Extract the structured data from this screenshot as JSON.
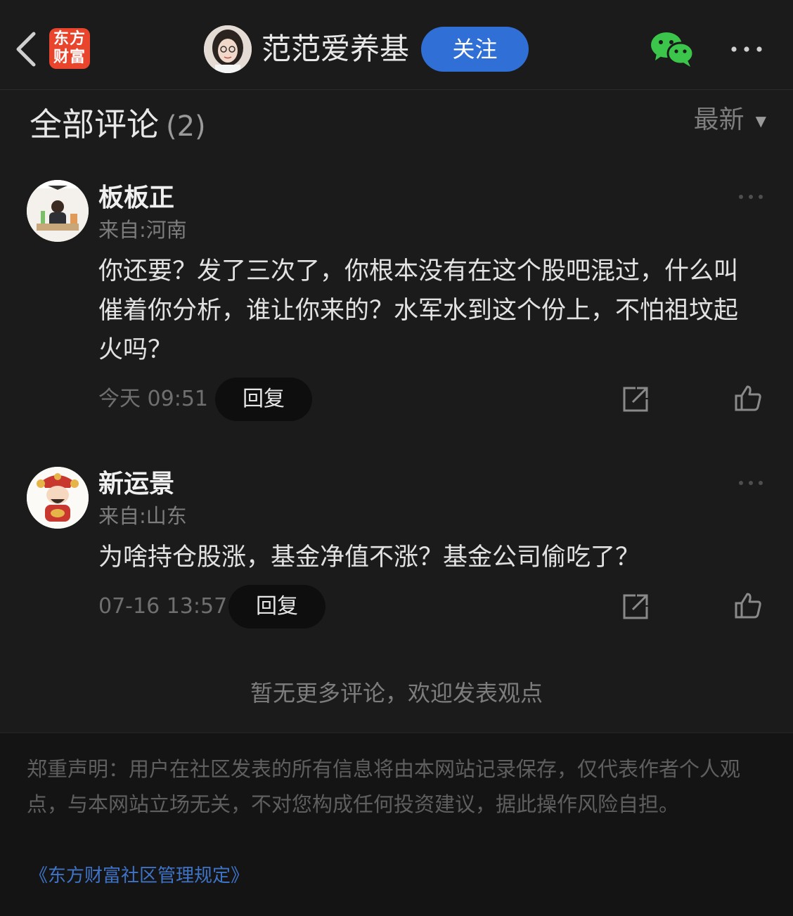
{
  "header": {
    "logo_line1": "东方",
    "logo_line2": "财富",
    "author_name": "范范爱养基",
    "follow_label": "关注"
  },
  "comments_section": {
    "title": "全部评论",
    "count": "(2)",
    "sort_label": "最新"
  },
  "comments": [
    {
      "username": "板板正",
      "location": "来自:河南",
      "text": "你还要？发了三次了，你根本没有在这个股吧混过，什么叫催着你分析，谁让你来的？水军水到这个份上，不怕祖坟起火吗？",
      "time": "今天 09:51",
      "reply_label": "回复"
    },
    {
      "username": "新运景",
      "location": "来自:山东",
      "text": "为啥持仓股涨，基金净值不涨？基金公司偷吃了？",
      "time": "07-16 13:57",
      "reply_label": "回复"
    }
  ],
  "no_more_text": "暂无更多评论，欢迎发表观点",
  "footer": {
    "disclaimer": "郑重声明：用户在社区发表的所有信息将由本网站记录保存，仅代表作者个人观点，与本网站立场无关，不对您构成任何投资建议，据此操作风险自担。",
    "rules_link": "《东方财富社区管理规定》"
  },
  "colors": {
    "background": "#1b1b1b",
    "follow_button": "#2f6fd6",
    "logo": "#e8452c",
    "link": "#3f73c7",
    "wechat": "#3bc54b"
  },
  "icons": [
    "back-chevron-icon",
    "wechat-icon",
    "more-dots-icon",
    "share-icon",
    "thumbs-up-icon"
  ]
}
